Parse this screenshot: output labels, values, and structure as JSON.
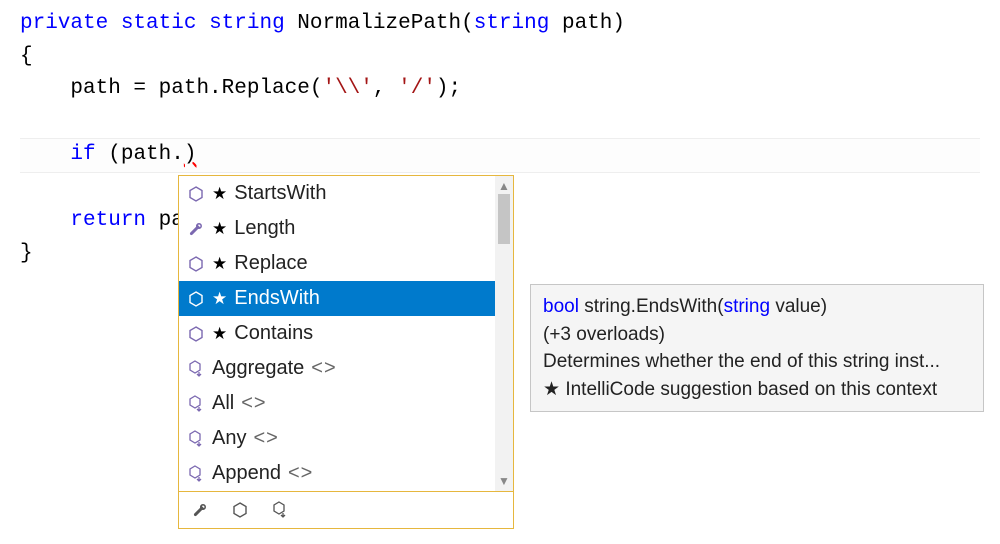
{
  "code": {
    "l1_private": "private",
    "l1_static": "static",
    "l1_string": "string",
    "l1_method": "NormalizePath",
    "l1_paren_open": "(",
    "l1_param_type": "string",
    "l1_param_name": " path)",
    "l2_brace": "{",
    "l3_indent": "    ",
    "l3_body": "path = path.Replace(",
    "l3_char1": "'\\\\'",
    "l3_comma": ", ",
    "l3_char2": "'/'",
    "l3_end": ");",
    "l4_blank": "",
    "l5_indent": "    ",
    "l5_if": "if",
    "l5_cond_open": " (path.",
    "l5_err_close": ")",
    "l6_blank": "",
    "l7_indent": "    ",
    "l7_return": "return",
    "l7_pa": " pa",
    "l8_brace": "}"
  },
  "intellisense": {
    "items": [
      {
        "icon": "method-icon",
        "starred": true,
        "label": "StartsWith",
        "generic": ""
      },
      {
        "icon": "wrench-icon",
        "starred": true,
        "label": "Length",
        "generic": ""
      },
      {
        "icon": "method-icon",
        "starred": true,
        "label": "Replace",
        "generic": ""
      },
      {
        "icon": "method-icon",
        "starred": true,
        "label": "EndsWith",
        "generic": ""
      },
      {
        "icon": "method-icon",
        "starred": true,
        "label": "Contains",
        "generic": ""
      },
      {
        "icon": "ext-method-icon",
        "starred": false,
        "label": "Aggregate",
        "generic": "<>"
      },
      {
        "icon": "ext-method-icon",
        "starred": false,
        "label": "All",
        "generic": "<>"
      },
      {
        "icon": "ext-method-icon",
        "starred": false,
        "label": "Any",
        "generic": "<>"
      },
      {
        "icon": "ext-method-icon",
        "starred": false,
        "label": "Append",
        "generic": "<>"
      }
    ],
    "selectedIndex": 3,
    "star": "★"
  },
  "footer_icons": [
    "wrench-icon",
    "method-icon",
    "ext-method-icon"
  ],
  "tooltip": {
    "sig_kw1": "bool",
    "sig_mid": " string.EndsWith(",
    "sig_kw2": "string",
    "sig_end": " value)",
    "overloads": "(+3 overloads)",
    "desc": "Determines whether the end of this string inst...",
    "star": "★",
    "intellicode": "IntelliCode suggestion based on this context"
  }
}
